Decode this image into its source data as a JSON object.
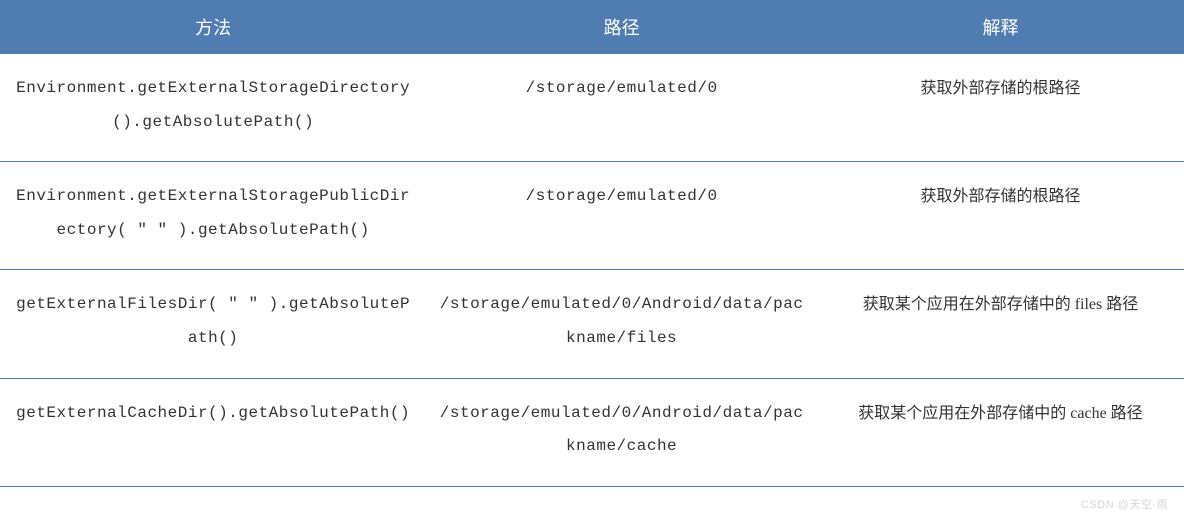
{
  "headers": {
    "method": "方法",
    "path": "路径",
    "desc": "解释"
  },
  "rows": [
    {
      "method": "Environment.getExternalStorageDirectory().getAbsolutePath()",
      "path": "/storage/emulated/0",
      "desc": "获取外部存储的根路径"
    },
    {
      "method": "Environment.getExternalStoragePublicDirectory( \" \" ).getAbsolutePath()",
      "path": "/storage/emulated/0",
      "desc": "获取外部存储的根路径"
    },
    {
      "method": "getExternalFilesDir( \" \" ).getAbsolutePath()",
      "path": "/storage/emulated/0/Android/data/packname/files",
      "desc": "获取某个应用在外部存储中的 files 路径"
    },
    {
      "method": "getExternalCacheDir().getAbsolutePath()",
      "path": "/storage/emulated/0/Android/data/packname/cache",
      "desc": "获取某个应用在外部存储中的 cache 路径"
    }
  ],
  "watermark": "CSDN @天空·雨"
}
